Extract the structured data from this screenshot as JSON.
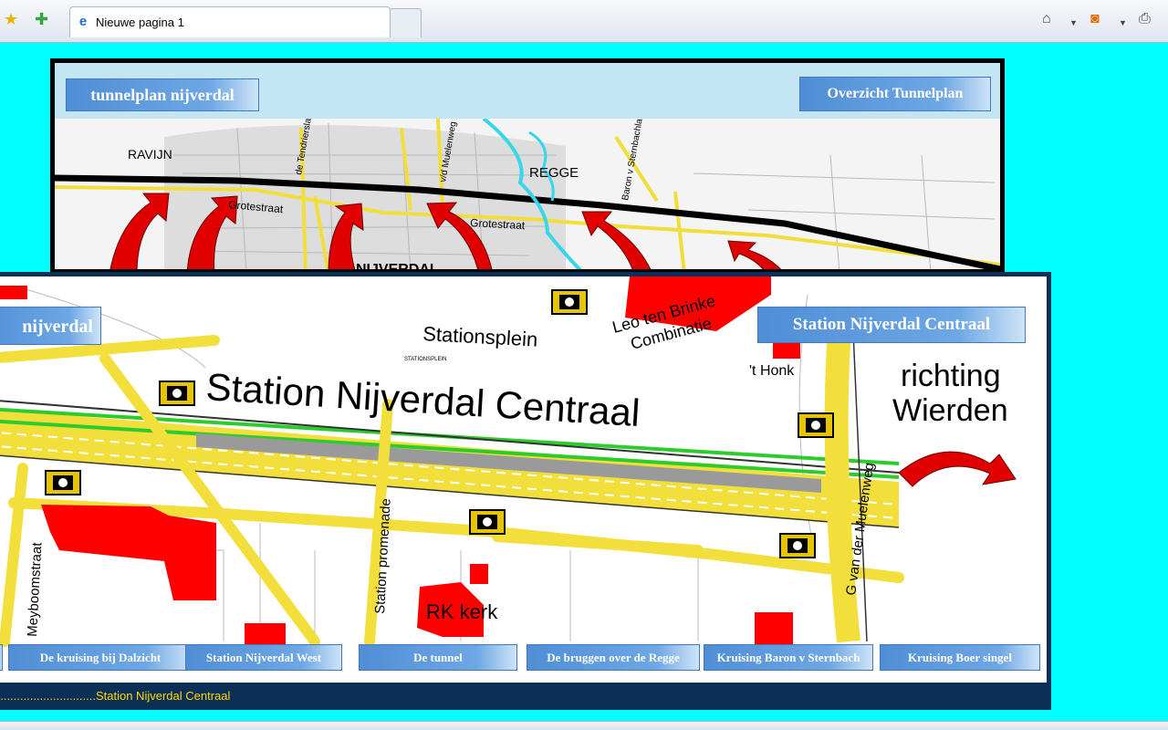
{
  "browser": {
    "tab_title": "Nieuwe pagina 1"
  },
  "top_panel": {
    "logo": "tunnelplan nijverdal",
    "overview_button": "Overzicht Tunnelplan",
    "map_labels": {
      "ravijn": "RAVIJN",
      "grotestraat_1": "Grotestraat",
      "grotestraat_2": "Grotestraat",
      "regge": "REGGE",
      "nijverdal": "NIJVERDAL",
      "street_1": "de Tendrierslaan",
      "street_2": "v/d Muelenweg",
      "street_3": "Baron v Sternbachlaan"
    }
  },
  "front_panel": {
    "logo": "nijverdal",
    "station_button": "Station Nijverdal Centraal",
    "map_labels": {
      "title": "Station Nijverdal Centraal",
      "stationsplein": "Stationsplein",
      "stationsplein_small": "STATIONSPLEIN",
      "leo_1": "Leo ten Brinke",
      "leo_2": "Combinatie",
      "honk": "'t Honk",
      "richting_1": "richting",
      "richting_2": "Wierden",
      "station_promenade": "Station promenade",
      "meyboomstraat": "Meyboomstraat",
      "g_van_der_muelenweg": "G van der Muelenweg",
      "rk_kerk": "RK kerk"
    },
    "nav": [
      "",
      "De kruising bij Dalzicht",
      "Station Nijverdal West",
      "De tunnel",
      "De bruggen over de Regge",
      "Kruising Baron v Sternbach",
      "Kruising Boer singel"
    ],
    "footer": "...............................Station Nijverdal Centraal"
  }
}
